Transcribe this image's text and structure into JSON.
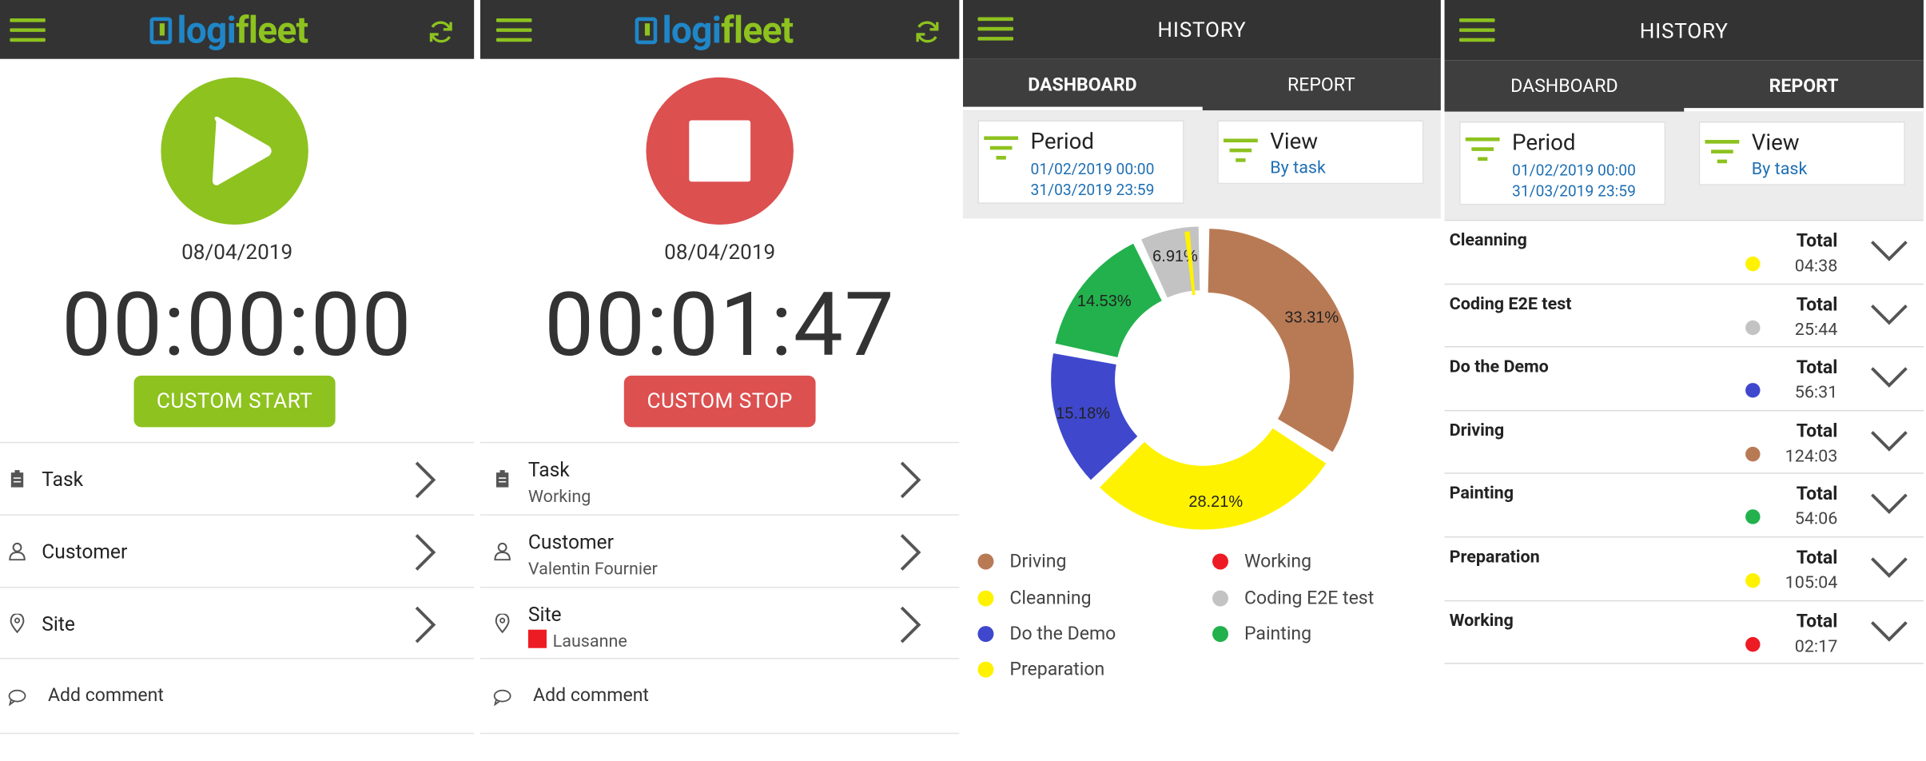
{
  "screens": [
    {
      "logo": {
        "left_text": "logi",
        "right_text": "fleet"
      },
      "date": "08/04/2019",
      "timer": "00:00:00",
      "action_button": "CUSTOM START",
      "rows": [
        {
          "label": "Task",
          "value": ""
        },
        {
          "label": "Customer",
          "value": ""
        },
        {
          "label": "Site",
          "value": ""
        }
      ],
      "comment": "Add comment"
    },
    {
      "logo": {
        "left_text": "logi",
        "right_text": "fleet"
      },
      "date": "08/04/2019",
      "timer": "00:01:47",
      "action_button": "CUSTOM STOP",
      "rows": [
        {
          "label": "Task",
          "value": "Working"
        },
        {
          "label": "Customer",
          "value": "Valentin Fournier"
        },
        {
          "label": "Site",
          "value": "Lausanne"
        }
      ],
      "comment": "Add comment"
    }
  ],
  "history": {
    "title": "HISTORY",
    "tabs": [
      "DASHBOARD",
      "REPORT"
    ],
    "period_label": "Period",
    "period_from": "01/02/2019 00:00",
    "period_to": "31/03/2019 23:59",
    "view_label": "View",
    "view_value": "By task"
  },
  "chart_data": {
    "type": "pie",
    "categories": [
      "Driving",
      "Cleanning",
      "Do the Demo",
      "Preparation",
      "Working",
      "Coding E2E test",
      "Painting"
    ],
    "values": [
      33.31,
      28.21,
      15.18,
      0,
      0,
      6.91,
      14.53
    ],
    "labels": [
      "33.31%",
      "28.21%",
      "15.18%",
      "",
      "",
      "6.91%",
      "14.53%"
    ],
    "legend_placement": "bottom"
  },
  "colors": {
    "green": "#8dc21f",
    "red": "#dc5050",
    "topbar": "#333333",
    "Driving": "#b87a55",
    "Cleanning": "#fff200",
    "Do the Demo": "#3f48cc",
    "Preparation": "#fff200",
    "Working": "#ed1c24",
    "Coding E2E test": "#c3c3c3",
    "Painting": "#22b14c",
    "site_color": "#ed1c24"
  },
  "report": {
    "total_label": "Total",
    "rows": [
      {
        "task": "Cleanning",
        "total": "04:38",
        "color": "#fff200"
      },
      {
        "task": "Coding E2E test",
        "total": "25:44",
        "color": "#c3c3c3"
      },
      {
        "task": "Do the Demo",
        "total": "56:31",
        "color": "#3f48cc"
      },
      {
        "task": "Driving",
        "total": "124:03",
        "color": "#b87a55"
      },
      {
        "task": "Painting",
        "total": "54:06",
        "color": "#22b14c"
      },
      {
        "task": "Preparation",
        "total": "105:04",
        "color": "#fff200"
      },
      {
        "task": "Working",
        "total": "02:17",
        "color": "#ed1c24"
      }
    ]
  }
}
